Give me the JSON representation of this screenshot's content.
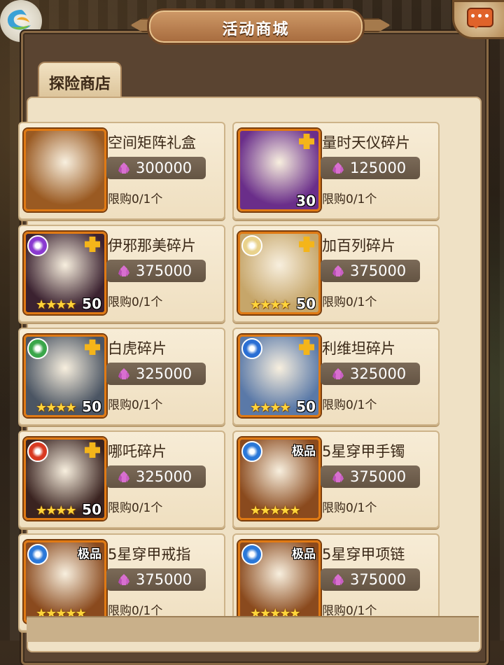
{
  "header": {
    "title": "活动商城",
    "chat_dots": "•••"
  },
  "tabs": [
    {
      "label": "探险商店"
    }
  ],
  "items": [
    {
      "name": "空间矩阵礼盒",
      "price": "300000",
      "limit": "限购0/1个",
      "count": "",
      "stars": "",
      "grade": "",
      "icon": "gift-box-icon",
      "bg": "#9a5a22"
    },
    {
      "name": "量时天仪碎片",
      "price": "125000",
      "limit": "限购0/1个",
      "count": "30",
      "stars": "",
      "grade": "",
      "icon": "astrolabe-icon",
      "bg": "#6a2e8a"
    },
    {
      "name": "伊邪那美碎片",
      "price": "375000",
      "limit": "限购0/1个",
      "count": "50",
      "stars": "★★★★",
      "grade": "",
      "icon": "hero-izanami-portrait",
      "bg": "#3b2230",
      "elem": "#8a3ad0"
    },
    {
      "name": "加百列碎片",
      "price": "375000",
      "limit": "限购0/1个",
      "count": "50",
      "stars": "★★★★",
      "grade": "",
      "icon": "hero-gabriel-portrait",
      "bg": "#c6a66a",
      "elem": "#e9d28c"
    },
    {
      "name": "白虎碎片",
      "price": "325000",
      "limit": "限购0/1个",
      "count": "50",
      "stars": "★★★★",
      "grade": "",
      "icon": "hero-white-tiger-portrait",
      "bg": "#4b5563",
      "elem": "#3aa64a"
    },
    {
      "name": "利维坦碎片",
      "price": "325000",
      "limit": "限购0/1个",
      "count": "50",
      "stars": "★★★★",
      "grade": "",
      "icon": "hero-leviathan-portrait",
      "bg": "#5a79a8",
      "elem": "#2b6fd4"
    },
    {
      "name": "哪吒碎片",
      "price": "325000",
      "limit": "限购0/1个",
      "count": "50",
      "stars": "★★★★",
      "grade": "",
      "icon": "hero-nezha-portrait",
      "bg": "#3a2320",
      "elem": "#d83a22"
    },
    {
      "name": "5星穿甲手镯",
      "price": "375000",
      "limit": "限购0/1个",
      "count": "",
      "stars": "★★★★★",
      "grade": "极品",
      "icon": "bracelet-icon",
      "bg": "#8a4a1e",
      "elem": "#2b78d8"
    },
    {
      "name": "5星穿甲戒指",
      "price": "375000",
      "limit": "限购0/1个",
      "count": "",
      "stars": "★★★★★",
      "grade": "极品",
      "icon": "ring-icon",
      "bg": "#8a4a1e",
      "elem": "#2b78d8"
    },
    {
      "name": "5星穿甲项链",
      "price": "375000",
      "limit": "限购0/1个",
      "count": "",
      "stars": "★★★★★",
      "grade": "极品",
      "icon": "necklace-icon",
      "bg": "#8a4a1e",
      "elem": "#2b78d8"
    }
  ]
}
